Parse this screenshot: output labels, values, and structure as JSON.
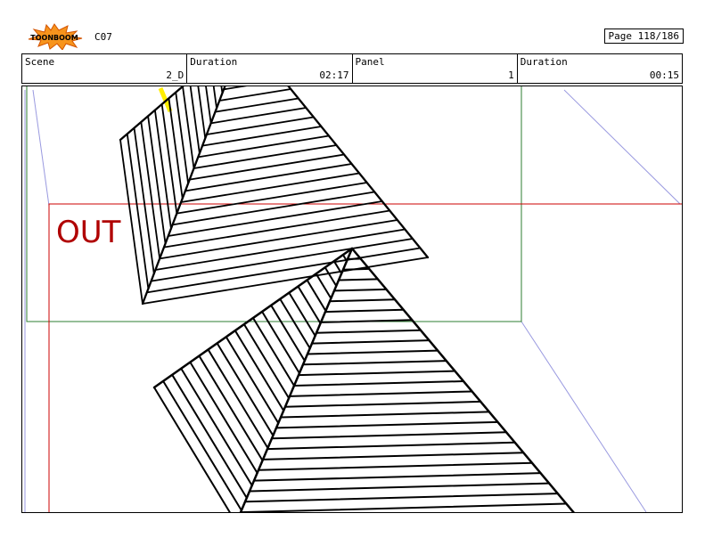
{
  "header": {
    "logo_text": "TOONBOOM",
    "code": "C07",
    "page": "Page 118/186"
  },
  "info": {
    "scene_label": "Scene",
    "scene_value": "2_D",
    "duration_label": "Duration",
    "duration_value": "02:17",
    "panel_label": "Panel",
    "panel_value": "1",
    "panel_duration_label": "Duration",
    "panel_duration_value": "00:15"
  },
  "panel": {
    "out_label": "OUT",
    "colors": {
      "out_frame": "#cc0000",
      "camera_frame": "#2e7d32",
      "perspective": "#9a9ae0",
      "highlight": "#ffee00"
    }
  }
}
